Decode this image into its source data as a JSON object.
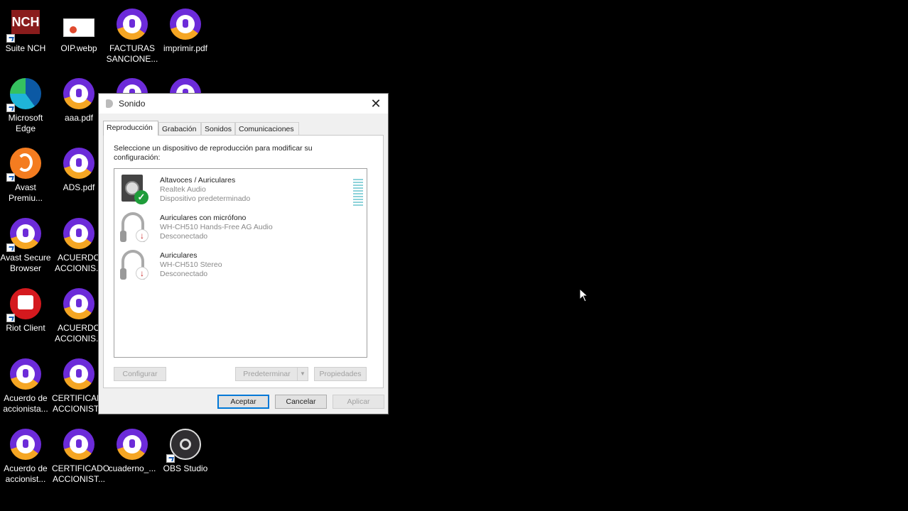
{
  "desktop": {
    "icons": [
      {
        "label": "Suite NCH",
        "type": "nch"
      },
      {
        "label": "OIP.webp",
        "type": "webp"
      },
      {
        "label": "FACTURAS SANCIONE...",
        "type": "avast"
      },
      {
        "label": "imprimir.pdf",
        "type": "avast"
      },
      {
        "label": "Microsoft Edge",
        "type": "edge"
      },
      {
        "label": "aaa.pdf",
        "type": "avast"
      },
      {
        "label": "Avast Premiu...",
        "type": "avast-premium"
      },
      {
        "label": "ADS.pdf",
        "type": "avast"
      },
      {
        "label": "Avast Secure Browser",
        "type": "avast"
      },
      {
        "label": "ACUERDO ACCIONIS...",
        "type": "avast"
      },
      {
        "label": "Riot Client",
        "type": "riot"
      },
      {
        "label": "ACUERDO ACCIONIS...",
        "type": "avast"
      },
      {
        "label": "Acuerdo de accionista...",
        "type": "avast"
      },
      {
        "label": "CERTIFICADO ACCIONIST...",
        "type": "avast"
      },
      {
        "label": "Acuerdo de accionist...",
        "type": "avast"
      },
      {
        "label": "CERTIFICADO ACCIONIST...",
        "type": "avast"
      },
      {
        "label": "cuaderno_...",
        "type": "avast"
      },
      {
        "label": "OBS Studio",
        "type": "obs"
      }
    ]
  },
  "dialog": {
    "title": "Sonido",
    "close_icon": "close-icon",
    "tabs": [
      "Reproducción",
      "Grabación",
      "Sonidos",
      "Comunicaciones"
    ],
    "active_tab": "Reproducción",
    "instruction": "Seleccione un dispositivo de reproducción para modificar su configuración:",
    "devices": [
      {
        "name": "Altavoces / Auriculares",
        "driver": "Realtek Audio",
        "status": "Dispositivo predeterminado",
        "icon": "speaker-icon",
        "badge": "check-icon"
      },
      {
        "name": "Auriculares con micrófono",
        "driver": "WH-CH510 Hands-Free AG Audio",
        "status": "Desconectado",
        "icon": "headset-icon",
        "badge": "disconnected-icon"
      },
      {
        "name": "Auriculares",
        "driver": "WH-CH510 Stereo",
        "status": "Desconectado",
        "icon": "headphones-icon",
        "badge": "disconnected-icon"
      }
    ],
    "buttons": {
      "configurar": "Configurar",
      "predeterminar": "Predeterminar",
      "propiedades": "Propiedades",
      "aceptar": "Aceptar",
      "cancelar": "Cancelar",
      "aplicar": "Aplicar"
    }
  }
}
